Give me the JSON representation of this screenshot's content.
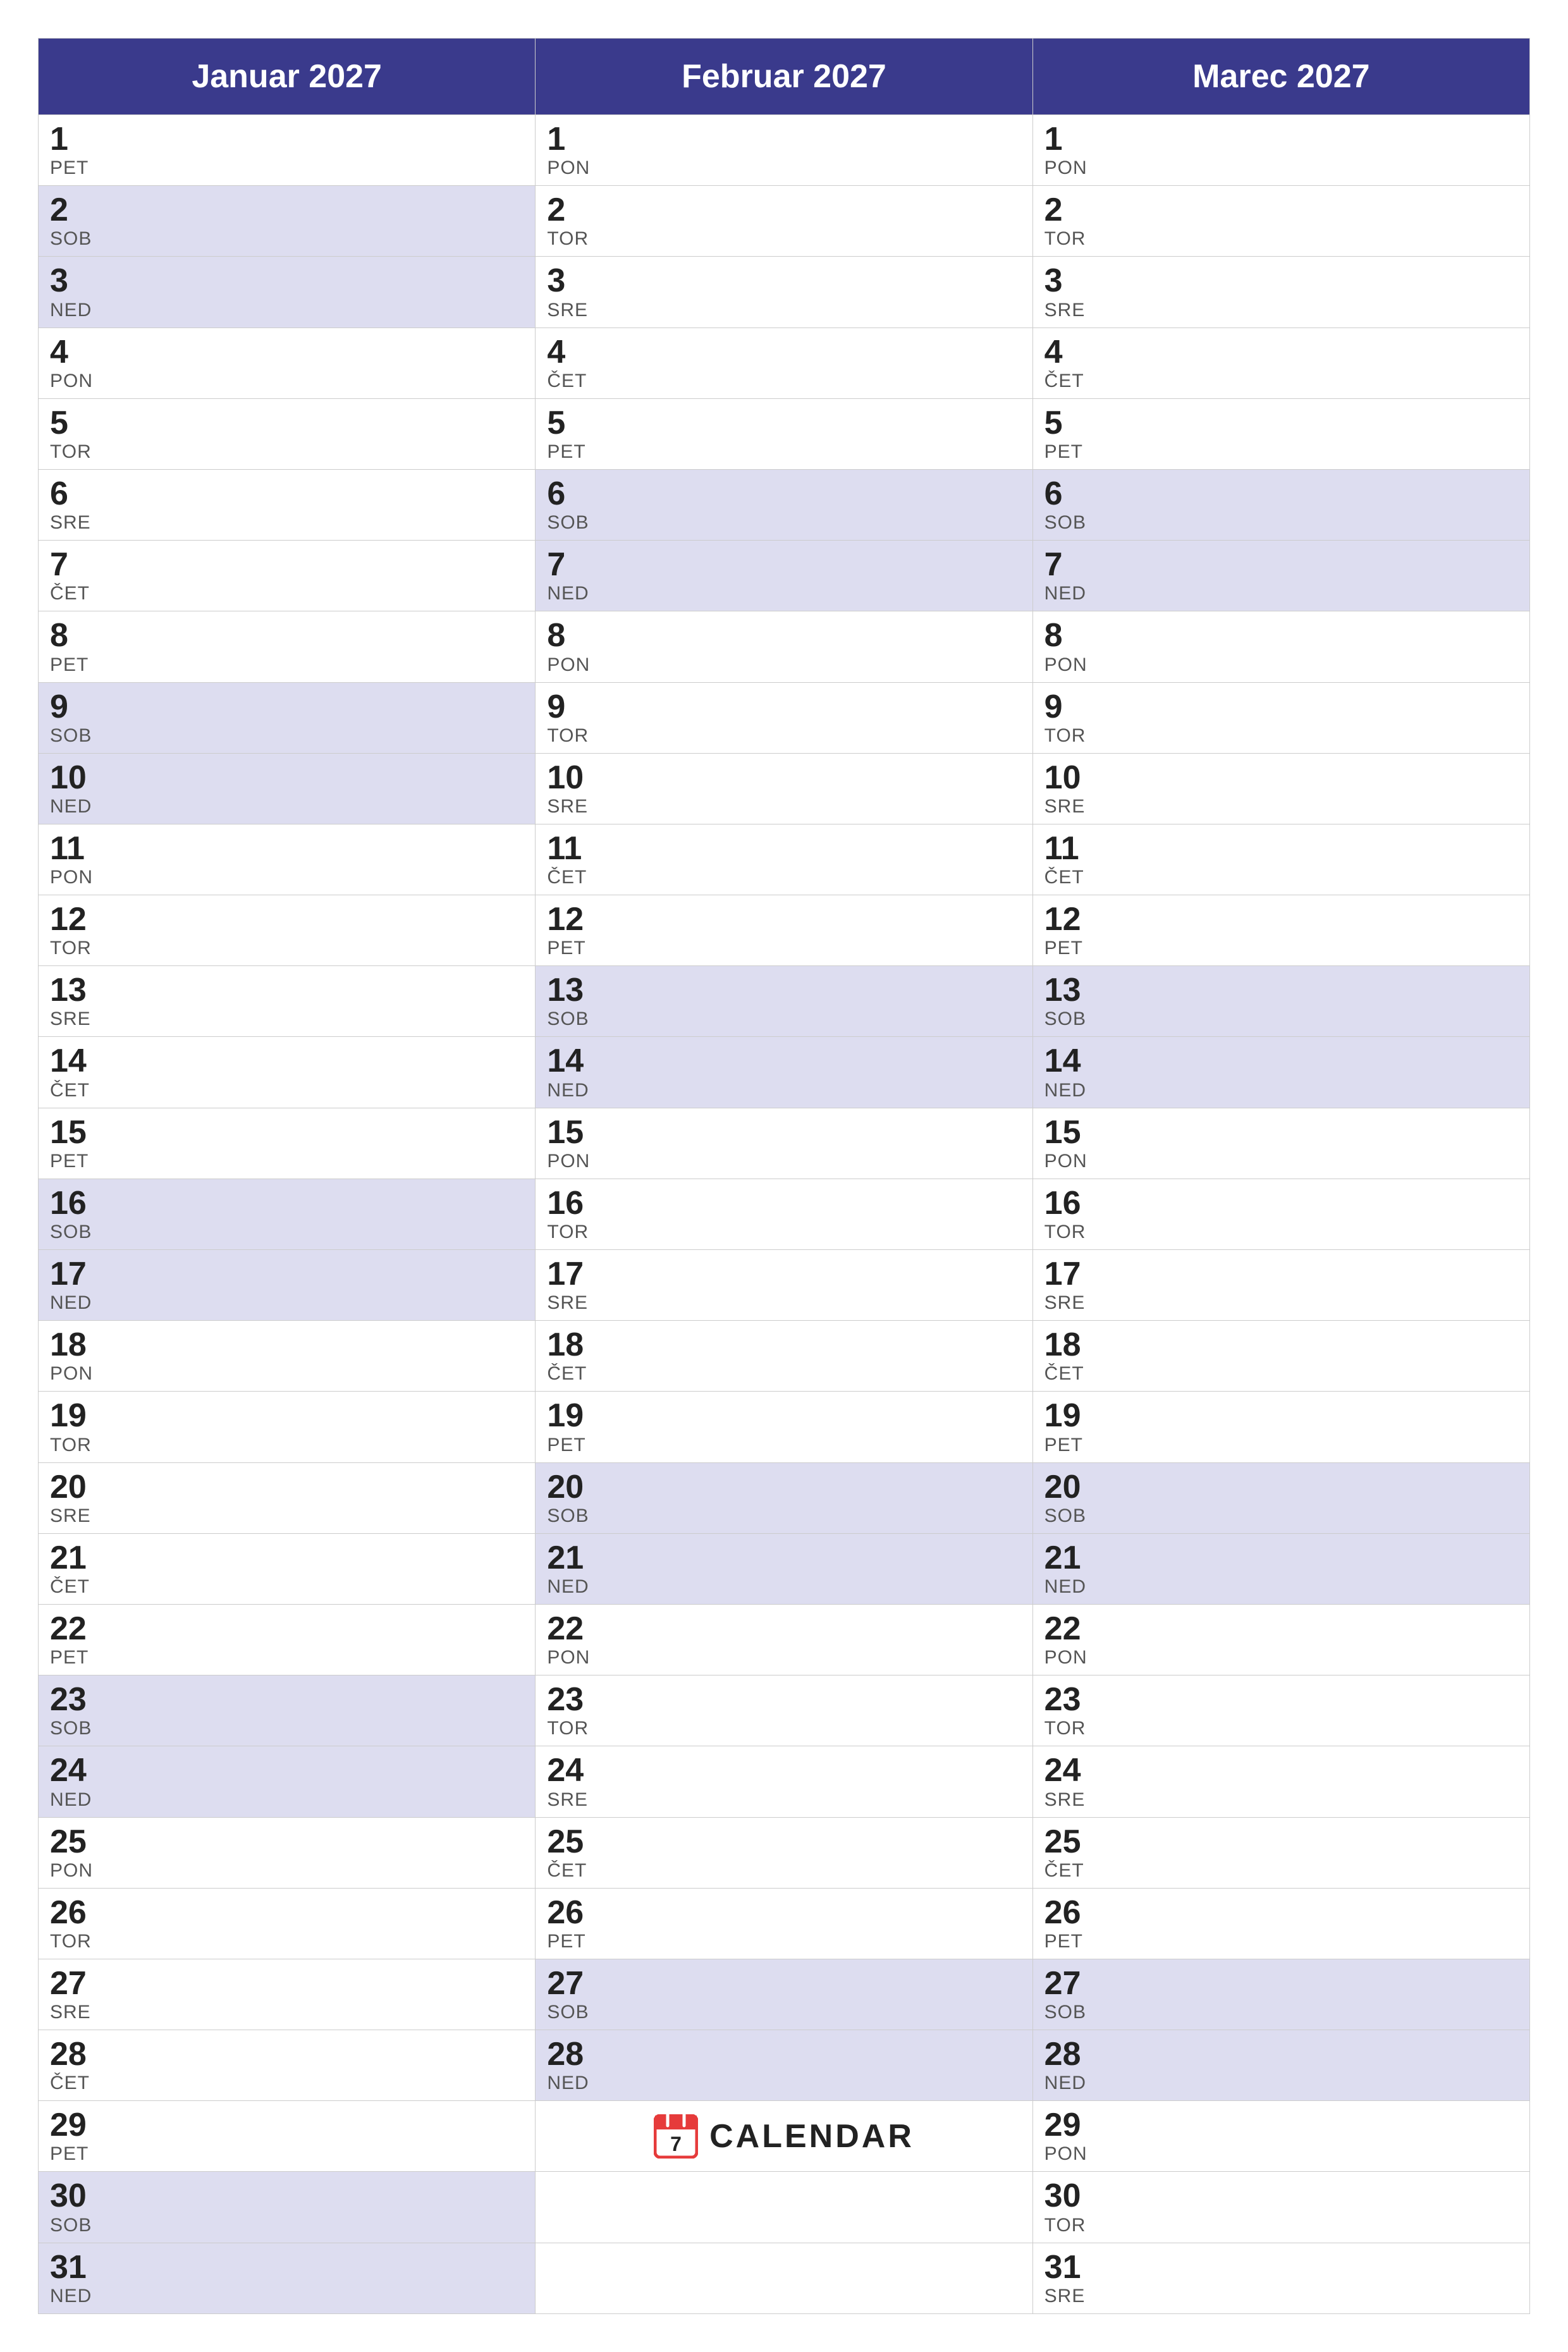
{
  "months": [
    {
      "name": "Januar 2027",
      "days": [
        {
          "num": 1,
          "day": "PET",
          "weekend": false
        },
        {
          "num": 2,
          "day": "SOB",
          "weekend": true
        },
        {
          "num": 3,
          "day": "NED",
          "weekend": true
        },
        {
          "num": 4,
          "day": "PON",
          "weekend": false
        },
        {
          "num": 5,
          "day": "TOR",
          "weekend": false
        },
        {
          "num": 6,
          "day": "SRE",
          "weekend": false
        },
        {
          "num": 7,
          "day": "ČET",
          "weekend": false
        },
        {
          "num": 8,
          "day": "PET",
          "weekend": false
        },
        {
          "num": 9,
          "day": "SOB",
          "weekend": true
        },
        {
          "num": 10,
          "day": "NED",
          "weekend": true
        },
        {
          "num": 11,
          "day": "PON",
          "weekend": false
        },
        {
          "num": 12,
          "day": "TOR",
          "weekend": false
        },
        {
          "num": 13,
          "day": "SRE",
          "weekend": false
        },
        {
          "num": 14,
          "day": "ČET",
          "weekend": false
        },
        {
          "num": 15,
          "day": "PET",
          "weekend": false
        },
        {
          "num": 16,
          "day": "SOB",
          "weekend": true
        },
        {
          "num": 17,
          "day": "NED",
          "weekend": true
        },
        {
          "num": 18,
          "day": "PON",
          "weekend": false
        },
        {
          "num": 19,
          "day": "TOR",
          "weekend": false
        },
        {
          "num": 20,
          "day": "SRE",
          "weekend": false
        },
        {
          "num": 21,
          "day": "ČET",
          "weekend": false
        },
        {
          "num": 22,
          "day": "PET",
          "weekend": false
        },
        {
          "num": 23,
          "day": "SOB",
          "weekend": true
        },
        {
          "num": 24,
          "day": "NED",
          "weekend": true
        },
        {
          "num": 25,
          "day": "PON",
          "weekend": false
        },
        {
          "num": 26,
          "day": "TOR",
          "weekend": false
        },
        {
          "num": 27,
          "day": "SRE",
          "weekend": false
        },
        {
          "num": 28,
          "day": "ČET",
          "weekend": false
        },
        {
          "num": 29,
          "day": "PET",
          "weekend": false
        },
        {
          "num": 30,
          "day": "SOB",
          "weekend": true
        },
        {
          "num": 31,
          "day": "NED",
          "weekend": true
        }
      ]
    },
    {
      "name": "Februar 2027",
      "days": [
        {
          "num": 1,
          "day": "PON",
          "weekend": false
        },
        {
          "num": 2,
          "day": "TOR",
          "weekend": false
        },
        {
          "num": 3,
          "day": "SRE",
          "weekend": false
        },
        {
          "num": 4,
          "day": "ČET",
          "weekend": false
        },
        {
          "num": 5,
          "day": "PET",
          "weekend": false
        },
        {
          "num": 6,
          "day": "SOB",
          "weekend": true
        },
        {
          "num": 7,
          "day": "NED",
          "weekend": true
        },
        {
          "num": 8,
          "day": "PON",
          "weekend": false
        },
        {
          "num": 9,
          "day": "TOR",
          "weekend": false
        },
        {
          "num": 10,
          "day": "SRE",
          "weekend": false
        },
        {
          "num": 11,
          "day": "ČET",
          "weekend": false
        },
        {
          "num": 12,
          "day": "PET",
          "weekend": false
        },
        {
          "num": 13,
          "day": "SOB",
          "weekend": true
        },
        {
          "num": 14,
          "day": "NED",
          "weekend": true
        },
        {
          "num": 15,
          "day": "PON",
          "weekend": false
        },
        {
          "num": 16,
          "day": "TOR",
          "weekend": false
        },
        {
          "num": 17,
          "day": "SRE",
          "weekend": false
        },
        {
          "num": 18,
          "day": "ČET",
          "weekend": false
        },
        {
          "num": 19,
          "day": "PET",
          "weekend": false
        },
        {
          "num": 20,
          "day": "SOB",
          "weekend": true
        },
        {
          "num": 21,
          "day": "NED",
          "weekend": true
        },
        {
          "num": 22,
          "day": "PON",
          "weekend": false
        },
        {
          "num": 23,
          "day": "TOR",
          "weekend": false
        },
        {
          "num": 24,
          "day": "SRE",
          "weekend": false
        },
        {
          "num": 25,
          "day": "ČET",
          "weekend": false
        },
        {
          "num": 26,
          "day": "PET",
          "weekend": false
        },
        {
          "num": 27,
          "day": "SOB",
          "weekend": true
        },
        {
          "num": 28,
          "day": "NED",
          "weekend": true
        }
      ]
    },
    {
      "name": "Marec 2027",
      "days": [
        {
          "num": 1,
          "day": "PON",
          "weekend": false
        },
        {
          "num": 2,
          "day": "TOR",
          "weekend": false
        },
        {
          "num": 3,
          "day": "SRE",
          "weekend": false
        },
        {
          "num": 4,
          "day": "ČET",
          "weekend": false
        },
        {
          "num": 5,
          "day": "PET",
          "weekend": false
        },
        {
          "num": 6,
          "day": "SOB",
          "weekend": true
        },
        {
          "num": 7,
          "day": "NED",
          "weekend": true
        },
        {
          "num": 8,
          "day": "PON",
          "weekend": false
        },
        {
          "num": 9,
          "day": "TOR",
          "weekend": false
        },
        {
          "num": 10,
          "day": "SRE",
          "weekend": false
        },
        {
          "num": 11,
          "day": "ČET",
          "weekend": false
        },
        {
          "num": 12,
          "day": "PET",
          "weekend": false
        },
        {
          "num": 13,
          "day": "SOB",
          "weekend": true
        },
        {
          "num": 14,
          "day": "NED",
          "weekend": true
        },
        {
          "num": 15,
          "day": "PON",
          "weekend": false
        },
        {
          "num": 16,
          "day": "TOR",
          "weekend": false
        },
        {
          "num": 17,
          "day": "SRE",
          "weekend": false
        },
        {
          "num": 18,
          "day": "ČET",
          "weekend": false
        },
        {
          "num": 19,
          "day": "PET",
          "weekend": false
        },
        {
          "num": 20,
          "day": "SOB",
          "weekend": true
        },
        {
          "num": 21,
          "day": "NED",
          "weekend": true
        },
        {
          "num": 22,
          "day": "PON",
          "weekend": false
        },
        {
          "num": 23,
          "day": "TOR",
          "weekend": false
        },
        {
          "num": 24,
          "day": "SRE",
          "weekend": false
        },
        {
          "num": 25,
          "day": "ČET",
          "weekend": false
        },
        {
          "num": 26,
          "day": "PET",
          "weekend": false
        },
        {
          "num": 27,
          "day": "SOB",
          "weekend": true
        },
        {
          "num": 28,
          "day": "NED",
          "weekend": true
        },
        {
          "num": 29,
          "day": "PON",
          "weekend": false
        },
        {
          "num": 30,
          "day": "TOR",
          "weekend": false
        },
        {
          "num": 31,
          "day": "SRE",
          "weekend": false
        }
      ]
    }
  ],
  "logo": {
    "text": "CALENDAR",
    "icon": "7"
  }
}
